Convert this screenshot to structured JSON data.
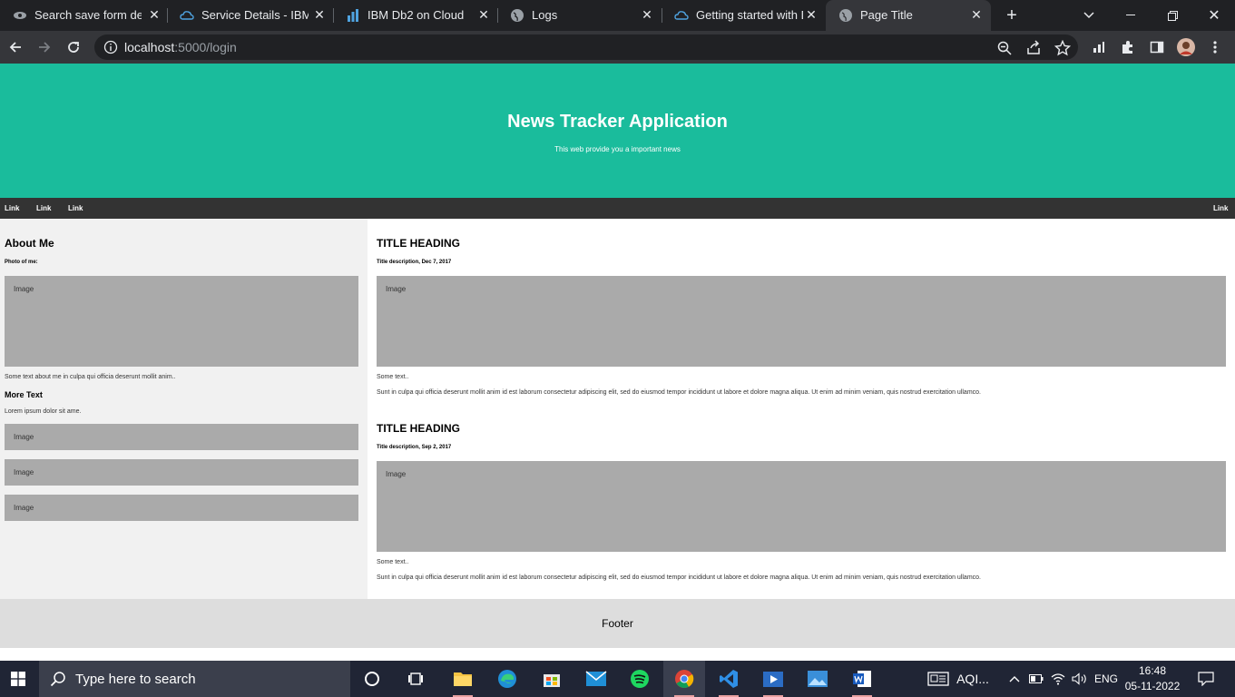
{
  "browser": {
    "tabs": [
      {
        "title": "Search save form deta",
        "icon": "tab-icon-ibm"
      },
      {
        "title": "Service Details - IBM C",
        "icon": "tab-icon-cloud"
      },
      {
        "title": "IBM Db2 on Cloud",
        "icon": "tab-icon-db2"
      },
      {
        "title": "Logs",
        "icon": "tab-icon-globe"
      },
      {
        "title": "Getting started with D",
        "icon": "tab-icon-cloud"
      },
      {
        "title": "Page Title",
        "icon": "tab-icon-globe"
      }
    ],
    "url_host": "localhost",
    "url_path": ":5000/login"
  },
  "page": {
    "header": {
      "title": "News Tracker Application",
      "subtitle": "This web provide you a important news"
    },
    "nav": {
      "links": [
        "Link",
        "Link",
        "Link"
      ],
      "right_link": "Link"
    },
    "side": {
      "heading": "About Me",
      "photo_label": "Photo of me:",
      "image_label": "Image",
      "about_text": "Some text about me in culpa qui officia deserunt mollit anim..",
      "more_heading": "More Text",
      "more_text": "Lorem ipsum dolor sit ame.",
      "small_images": [
        "Image",
        "Image",
        "Image"
      ]
    },
    "posts": [
      {
        "title": "TITLE HEADING",
        "description": "Title description, Dec 7, 2017",
        "image_label": "Image",
        "some_text": "Some text..",
        "body": "Sunt in culpa qui officia deserunt mollit anim id est laborum consectetur adipiscing elit, sed do eiusmod tempor incididunt ut labore et dolore magna aliqua. Ut enim ad minim veniam, quis nostrud exercitation ullamco."
      },
      {
        "title": "TITLE HEADING",
        "description": "Title description, Sep 2, 2017",
        "image_label": "Image",
        "some_text": "Some text..",
        "body": "Sunt in culpa qui officia deserunt mollit anim id est laborum consectetur adipiscing elit, sed do eiusmod tempor incididunt ut labore et dolore magna aliqua. Ut enim ad minim veniam, quis nostrud exercitation ullamco."
      }
    ],
    "footer": "Footer",
    "colors": {
      "header_bg": "#1abc9c",
      "nav_bg": "#333333",
      "side_bg": "#f1f1f1",
      "image_bg": "#aaaaaa",
      "footer_bg": "#dddddd"
    }
  },
  "taskbar": {
    "search_placeholder": "Type here to search",
    "apps": [
      "task-view-icon",
      "file-explorer-icon",
      "edge-icon",
      "store-icon",
      "mail-icon",
      "spotify-icon",
      "chrome-icon",
      "vscode-icon",
      "video-editor-icon",
      "photos-icon",
      "word-icon"
    ],
    "news_widget": "AQI...",
    "language": "ENG",
    "time": "16:48",
    "date": "05-11-2022"
  }
}
